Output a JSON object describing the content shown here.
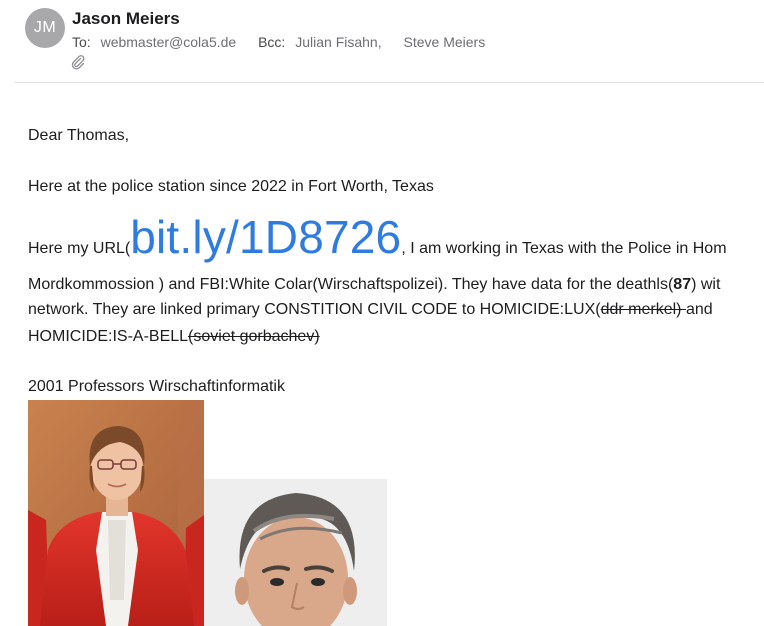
{
  "header": {
    "avatar_initials": "JM",
    "sender_name": "Jason Meiers",
    "to_label": "To:",
    "to_value": "webmaster@cola5.de",
    "bcc_label": "Bcc:",
    "bcc_1": "Julian Fisahn,",
    "bcc_2": "Steve Meiers",
    "attachment_icon": "paperclip-icon"
  },
  "body": {
    "greeting": "Dear Thomas,",
    "line1": "Here at the police station since 2022 in Fort Worth, Texas",
    "line2_pre": "Here my URL(",
    "line2_url": "bit.ly/1D8726",
    "line2_post": ", I am working in Texas with the Police in Hom",
    "line3_a": "Mordkommossion ) and FBI:White Colar(Wirschaftspolizei). They have data for the deathls(",
    "line3_num": "87",
    "line3_b": ") wit",
    "line4_a": "network. They are linked primary CONSTITION CIVIL CODE to HOMICIDE:LUX(",
    "line4_strike": "ddr merkel) ",
    "line4_b": "and",
    "line5_a": "HOMICIDE:IS-A-BELL",
    "line5_strike": "(soviet gorbachev)",
    "section_title": "2001 Professors Wirschaftinformatik"
  },
  "colors": {
    "link": "#2f7ce0",
    "text": "#1d1d1f",
    "avatar": "#a8a8ab"
  }
}
